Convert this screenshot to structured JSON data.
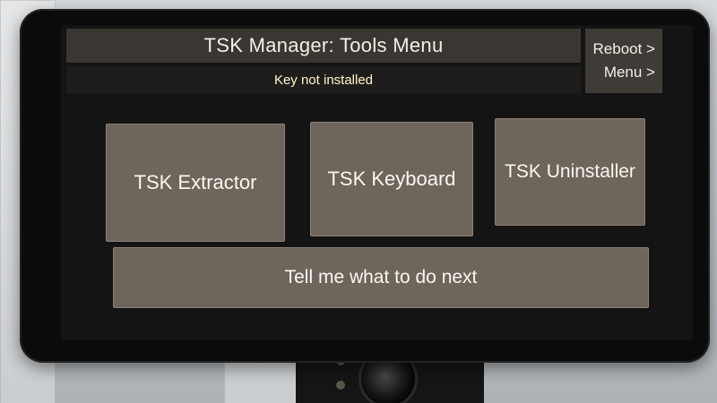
{
  "screen": {
    "title": "TSK Manager: Tools Menu",
    "status": "Key not installed",
    "side_menu": {
      "reboot": "Reboot >",
      "menu": "Menu >"
    },
    "tools": {
      "extractor": "TSK Extractor",
      "keyboard": "TSK Keyboard",
      "uninstaller": "TSK Uninstaller"
    },
    "next_button": "Tell me what to do next"
  },
  "colors": {
    "title_bar": "#3a3632",
    "button_face": "#6e655c",
    "status_text": "#fff6c8",
    "bezel": "#0b0b0c"
  }
}
